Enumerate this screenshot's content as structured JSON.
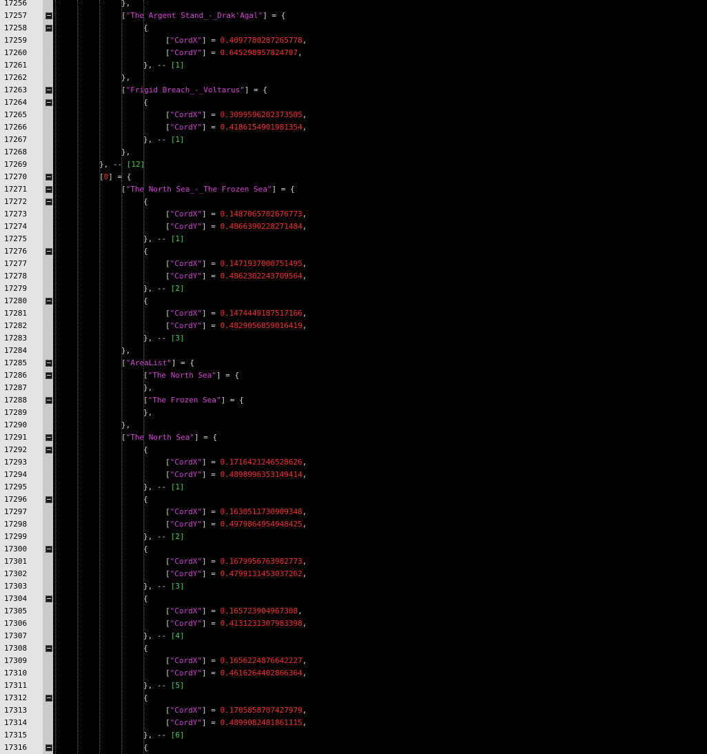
{
  "lines": [
    {
      "num": "17256",
      "fold": false,
      "indent": 3,
      "tokens": [
        {
          "t": "p",
          "v": "},"
        }
      ]
    },
    {
      "num": "17257",
      "fold": true,
      "indent": 3,
      "tokens": [
        {
          "t": "p",
          "v": "["
        },
        {
          "t": "s",
          "v": "\"The Argent Stand_-_Drak'Agal\""
        },
        {
          "t": "p",
          "v": "] = {"
        }
      ]
    },
    {
      "num": "17258",
      "fold": true,
      "indent": 4,
      "tokens": [
        {
          "t": "p",
          "v": "{"
        }
      ]
    },
    {
      "num": "17259",
      "fold": false,
      "indent": 5,
      "tokens": [
        {
          "t": "p",
          "v": "["
        },
        {
          "t": "s",
          "v": "\"CordX\""
        },
        {
          "t": "p",
          "v": "] = "
        },
        {
          "t": "n",
          "v": "0.4097780287265778"
        },
        {
          "t": "p",
          "v": ","
        }
      ]
    },
    {
      "num": "17260",
      "fold": false,
      "indent": 5,
      "tokens": [
        {
          "t": "p",
          "v": "["
        },
        {
          "t": "s",
          "v": "\"CordY\""
        },
        {
          "t": "p",
          "v": "] = "
        },
        {
          "t": "n",
          "v": "0.645298957824707"
        },
        {
          "t": "p",
          "v": ","
        }
      ]
    },
    {
      "num": "17261",
      "fold": false,
      "indent": 4,
      "tokens": [
        {
          "t": "p",
          "v": "}, -- "
        },
        {
          "t": "g",
          "v": "[1]"
        }
      ]
    },
    {
      "num": "17262",
      "fold": false,
      "indent": 3,
      "tokens": [
        {
          "t": "p",
          "v": "},"
        }
      ]
    },
    {
      "num": "17263",
      "fold": true,
      "indent": 3,
      "tokens": [
        {
          "t": "p",
          "v": "["
        },
        {
          "t": "s",
          "v": "\"Frigid Breach_-_Voltarus\""
        },
        {
          "t": "p",
          "v": "] = {"
        }
      ]
    },
    {
      "num": "17264",
      "fold": true,
      "indent": 4,
      "tokens": [
        {
          "t": "p",
          "v": "{"
        }
      ]
    },
    {
      "num": "17265",
      "fold": false,
      "indent": 5,
      "tokens": [
        {
          "t": "p",
          "v": "["
        },
        {
          "t": "s",
          "v": "\"CordX\""
        },
        {
          "t": "p",
          "v": "] = "
        },
        {
          "t": "n",
          "v": "0.3099596202373505"
        },
        {
          "t": "p",
          "v": ","
        }
      ]
    },
    {
      "num": "17266",
      "fold": false,
      "indent": 5,
      "tokens": [
        {
          "t": "p",
          "v": "["
        },
        {
          "t": "s",
          "v": "\"CordY\""
        },
        {
          "t": "p",
          "v": "] = "
        },
        {
          "t": "n",
          "v": "0.4186154901981354"
        },
        {
          "t": "p",
          "v": ","
        }
      ]
    },
    {
      "num": "17267",
      "fold": false,
      "indent": 4,
      "tokens": [
        {
          "t": "p",
          "v": "}, -- "
        },
        {
          "t": "g",
          "v": "[1]"
        }
      ]
    },
    {
      "num": "17268",
      "fold": false,
      "indent": 3,
      "tokens": [
        {
          "t": "p",
          "v": "},"
        }
      ]
    },
    {
      "num": "17269",
      "fold": false,
      "indent": 2,
      "tokens": [
        {
          "t": "p",
          "v": "}, -- "
        },
        {
          "t": "g",
          "v": "[12]"
        }
      ]
    },
    {
      "num": "17270",
      "fold": true,
      "indent": 2,
      "tokens": [
        {
          "t": "p",
          "v": "["
        },
        {
          "t": "k",
          "v": "0"
        },
        {
          "t": "p",
          "v": "] = {"
        }
      ]
    },
    {
      "num": "17271",
      "fold": true,
      "indent": 3,
      "tokens": [
        {
          "t": "p",
          "v": "["
        },
        {
          "t": "s",
          "v": "\"The North Sea_-_The Frozen Sea\""
        },
        {
          "t": "p",
          "v": "] = {"
        }
      ]
    },
    {
      "num": "17272",
      "fold": true,
      "indent": 4,
      "tokens": [
        {
          "t": "p",
          "v": "{"
        }
      ]
    },
    {
      "num": "17273",
      "fold": false,
      "indent": 5,
      "tokens": [
        {
          "t": "p",
          "v": "["
        },
        {
          "t": "s",
          "v": "\"CordX\""
        },
        {
          "t": "p",
          "v": "] = "
        },
        {
          "t": "n",
          "v": "0.1487065702676773"
        },
        {
          "t": "p",
          "v": ","
        }
      ]
    },
    {
      "num": "17274",
      "fold": false,
      "indent": 5,
      "tokens": [
        {
          "t": "p",
          "v": "["
        },
        {
          "t": "s",
          "v": "\"CordY\""
        },
        {
          "t": "p",
          "v": "] = "
        },
        {
          "t": "n",
          "v": "0.4866390228271484"
        },
        {
          "t": "p",
          "v": ","
        }
      ]
    },
    {
      "num": "17275",
      "fold": false,
      "indent": 4,
      "tokens": [
        {
          "t": "p",
          "v": "}, -- "
        },
        {
          "t": "g",
          "v": "[1]"
        }
      ]
    },
    {
      "num": "17276",
      "fold": true,
      "indent": 4,
      "tokens": [
        {
          "t": "p",
          "v": "{"
        }
      ]
    },
    {
      "num": "17277",
      "fold": false,
      "indent": 5,
      "tokens": [
        {
          "t": "p",
          "v": "["
        },
        {
          "t": "s",
          "v": "\"CordX\""
        },
        {
          "t": "p",
          "v": "] = "
        },
        {
          "t": "n",
          "v": "0.1471937000751495"
        },
        {
          "t": "p",
          "v": ","
        }
      ]
    },
    {
      "num": "17278",
      "fold": false,
      "indent": 5,
      "tokens": [
        {
          "t": "p",
          "v": "["
        },
        {
          "t": "s",
          "v": "\"CordY\""
        },
        {
          "t": "p",
          "v": "] = "
        },
        {
          "t": "n",
          "v": "0.4862302243709564"
        },
        {
          "t": "p",
          "v": ","
        }
      ]
    },
    {
      "num": "17279",
      "fold": false,
      "indent": 4,
      "tokens": [
        {
          "t": "p",
          "v": "}, -- "
        },
        {
          "t": "g",
          "v": "[2]"
        }
      ]
    },
    {
      "num": "17280",
      "fold": true,
      "indent": 4,
      "tokens": [
        {
          "t": "p",
          "v": "{"
        }
      ]
    },
    {
      "num": "17281",
      "fold": false,
      "indent": 5,
      "tokens": [
        {
          "t": "p",
          "v": "["
        },
        {
          "t": "s",
          "v": "\"CordX\""
        },
        {
          "t": "p",
          "v": "] = "
        },
        {
          "t": "n",
          "v": "0.1474449187517166"
        },
        {
          "t": "p",
          "v": ","
        }
      ]
    },
    {
      "num": "17282",
      "fold": false,
      "indent": 5,
      "tokens": [
        {
          "t": "p",
          "v": "["
        },
        {
          "t": "s",
          "v": "\"CordY\""
        },
        {
          "t": "p",
          "v": "] = "
        },
        {
          "t": "n",
          "v": "0.4829056859016419"
        },
        {
          "t": "p",
          "v": ","
        }
      ]
    },
    {
      "num": "17283",
      "fold": false,
      "indent": 4,
      "tokens": [
        {
          "t": "p",
          "v": "}, -- "
        },
        {
          "t": "g",
          "v": "[3]"
        }
      ]
    },
    {
      "num": "17284",
      "fold": false,
      "indent": 3,
      "tokens": [
        {
          "t": "p",
          "v": "},"
        }
      ]
    },
    {
      "num": "17285",
      "fold": true,
      "indent": 3,
      "tokens": [
        {
          "t": "p",
          "v": "["
        },
        {
          "t": "s",
          "v": "\"AreaList\""
        },
        {
          "t": "p",
          "v": "] = {"
        }
      ]
    },
    {
      "num": "17286",
      "fold": true,
      "indent": 4,
      "tokens": [
        {
          "t": "p",
          "v": "["
        },
        {
          "t": "s",
          "v": "\"The North Sea\""
        },
        {
          "t": "p",
          "v": "] = {"
        }
      ]
    },
    {
      "num": "17287",
      "fold": false,
      "indent": 4,
      "tokens": [
        {
          "t": "p",
          "v": "},"
        }
      ]
    },
    {
      "num": "17288",
      "fold": true,
      "indent": 4,
      "tokens": [
        {
          "t": "p",
          "v": "["
        },
        {
          "t": "s",
          "v": "\"The Frozen Sea\""
        },
        {
          "t": "p",
          "v": "] = {"
        }
      ]
    },
    {
      "num": "17289",
      "fold": false,
      "indent": 4,
      "tokens": [
        {
          "t": "p",
          "v": "},"
        }
      ]
    },
    {
      "num": "17290",
      "fold": false,
      "indent": 3,
      "tokens": [
        {
          "t": "p",
          "v": "},"
        }
      ]
    },
    {
      "num": "17291",
      "fold": true,
      "indent": 3,
      "tokens": [
        {
          "t": "p",
          "v": "["
        },
        {
          "t": "s",
          "v": "\"The North Sea\""
        },
        {
          "t": "p",
          "v": "] = {"
        }
      ]
    },
    {
      "num": "17292",
      "fold": true,
      "indent": 4,
      "tokens": [
        {
          "t": "p",
          "v": "{"
        }
      ]
    },
    {
      "num": "17293",
      "fold": false,
      "indent": 5,
      "tokens": [
        {
          "t": "p",
          "v": "["
        },
        {
          "t": "s",
          "v": "\"CordX\""
        },
        {
          "t": "p",
          "v": "] = "
        },
        {
          "t": "n",
          "v": "0.1716421246528626"
        },
        {
          "t": "p",
          "v": ","
        }
      ]
    },
    {
      "num": "17294",
      "fold": false,
      "indent": 5,
      "tokens": [
        {
          "t": "p",
          "v": "["
        },
        {
          "t": "s",
          "v": "\"CordY\""
        },
        {
          "t": "p",
          "v": "] = "
        },
        {
          "t": "n",
          "v": "0.4898996353149414"
        },
        {
          "t": "p",
          "v": ","
        }
      ]
    },
    {
      "num": "17295",
      "fold": false,
      "indent": 4,
      "tokens": [
        {
          "t": "p",
          "v": "}, -- "
        },
        {
          "t": "g",
          "v": "[1]"
        }
      ]
    },
    {
      "num": "17296",
      "fold": true,
      "indent": 4,
      "tokens": [
        {
          "t": "p",
          "v": "{"
        }
      ]
    },
    {
      "num": "17297",
      "fold": false,
      "indent": 5,
      "tokens": [
        {
          "t": "p",
          "v": "["
        },
        {
          "t": "s",
          "v": "\"CordX\""
        },
        {
          "t": "p",
          "v": "] = "
        },
        {
          "t": "n",
          "v": "0.1630511730909348"
        },
        {
          "t": "p",
          "v": ","
        }
      ]
    },
    {
      "num": "17298",
      "fold": false,
      "indent": 5,
      "tokens": [
        {
          "t": "p",
          "v": "["
        },
        {
          "t": "s",
          "v": "\"CordY\""
        },
        {
          "t": "p",
          "v": "] = "
        },
        {
          "t": "n",
          "v": "0.4979864954948425"
        },
        {
          "t": "p",
          "v": ","
        }
      ]
    },
    {
      "num": "17299",
      "fold": false,
      "indent": 4,
      "tokens": [
        {
          "t": "p",
          "v": "}, -- "
        },
        {
          "t": "g",
          "v": "[2]"
        }
      ]
    },
    {
      "num": "17300",
      "fold": true,
      "indent": 4,
      "tokens": [
        {
          "t": "p",
          "v": "{"
        }
      ]
    },
    {
      "num": "17301",
      "fold": false,
      "indent": 5,
      "tokens": [
        {
          "t": "p",
          "v": "["
        },
        {
          "t": "s",
          "v": "\"CordX\""
        },
        {
          "t": "p",
          "v": "] = "
        },
        {
          "t": "n",
          "v": "0.1679956763982773"
        },
        {
          "t": "p",
          "v": ","
        }
      ]
    },
    {
      "num": "17302",
      "fold": false,
      "indent": 5,
      "tokens": [
        {
          "t": "p",
          "v": "["
        },
        {
          "t": "s",
          "v": "\"CordY\""
        },
        {
          "t": "p",
          "v": "] = "
        },
        {
          "t": "n",
          "v": "0.4799131453037262"
        },
        {
          "t": "p",
          "v": ","
        }
      ]
    },
    {
      "num": "17303",
      "fold": false,
      "indent": 4,
      "tokens": [
        {
          "t": "p",
          "v": "}, -- "
        },
        {
          "t": "g",
          "v": "[3]"
        }
      ]
    },
    {
      "num": "17304",
      "fold": true,
      "indent": 4,
      "tokens": [
        {
          "t": "p",
          "v": "{"
        }
      ]
    },
    {
      "num": "17305",
      "fold": false,
      "indent": 5,
      "tokens": [
        {
          "t": "p",
          "v": "["
        },
        {
          "t": "s",
          "v": "\"CordX\""
        },
        {
          "t": "p",
          "v": "] = "
        },
        {
          "t": "n",
          "v": "0.165723904967308"
        },
        {
          "t": "p",
          "v": ","
        }
      ]
    },
    {
      "num": "17306",
      "fold": false,
      "indent": 5,
      "tokens": [
        {
          "t": "p",
          "v": "["
        },
        {
          "t": "s",
          "v": "\"CordY\""
        },
        {
          "t": "p",
          "v": "] = "
        },
        {
          "t": "n",
          "v": "0.4131231307983398"
        },
        {
          "t": "p",
          "v": ","
        }
      ]
    },
    {
      "num": "17307",
      "fold": false,
      "indent": 4,
      "tokens": [
        {
          "t": "p",
          "v": "}, -- "
        },
        {
          "t": "g",
          "v": "[4]"
        }
      ]
    },
    {
      "num": "17308",
      "fold": true,
      "indent": 4,
      "tokens": [
        {
          "t": "p",
          "v": "{"
        }
      ]
    },
    {
      "num": "17309",
      "fold": false,
      "indent": 5,
      "tokens": [
        {
          "t": "p",
          "v": "["
        },
        {
          "t": "s",
          "v": "\"CordX\""
        },
        {
          "t": "p",
          "v": "] = "
        },
        {
          "t": "n",
          "v": "0.1656224876642227"
        },
        {
          "t": "p",
          "v": ","
        }
      ]
    },
    {
      "num": "17310",
      "fold": false,
      "indent": 5,
      "tokens": [
        {
          "t": "p",
          "v": "["
        },
        {
          "t": "s",
          "v": "\"CordY\""
        },
        {
          "t": "p",
          "v": "] = "
        },
        {
          "t": "n",
          "v": "0.4616264402866364"
        },
        {
          "t": "p",
          "v": ","
        }
      ]
    },
    {
      "num": "17311",
      "fold": false,
      "indent": 4,
      "tokens": [
        {
          "t": "p",
          "v": "}, -- "
        },
        {
          "t": "g",
          "v": "[5]"
        }
      ]
    },
    {
      "num": "17312",
      "fold": true,
      "indent": 4,
      "tokens": [
        {
          "t": "p",
          "v": "{"
        }
      ]
    },
    {
      "num": "17313",
      "fold": false,
      "indent": 5,
      "tokens": [
        {
          "t": "p",
          "v": "["
        },
        {
          "t": "s",
          "v": "\"CordX\""
        },
        {
          "t": "p",
          "v": "] = "
        },
        {
          "t": "n",
          "v": "0.1705858707427979"
        },
        {
          "t": "p",
          "v": ","
        }
      ]
    },
    {
      "num": "17314",
      "fold": false,
      "indent": 5,
      "tokens": [
        {
          "t": "p",
          "v": "["
        },
        {
          "t": "s",
          "v": "\"CordY\""
        },
        {
          "t": "p",
          "v": "] = "
        },
        {
          "t": "n",
          "v": "0.4899082481861115"
        },
        {
          "t": "p",
          "v": ","
        }
      ]
    },
    {
      "num": "17315",
      "fold": false,
      "indent": 4,
      "tokens": [
        {
          "t": "p",
          "v": "}, -- "
        },
        {
          "t": "g",
          "v": "[6]"
        }
      ]
    },
    {
      "num": "17316",
      "fold": true,
      "indent": 4,
      "tokens": [
        {
          "t": "p",
          "v": "{"
        }
      ]
    }
  ],
  "colors": {
    "gutter_background": "#e4e4e4",
    "editor_background": "#000000",
    "punctuation": "#d8d8d8",
    "string": "#d83dd8",
    "number": "#ff2a2a",
    "comment_index": "#3fd23f"
  },
  "icons": {
    "fold_marker": "fold-minus-icon"
  }
}
